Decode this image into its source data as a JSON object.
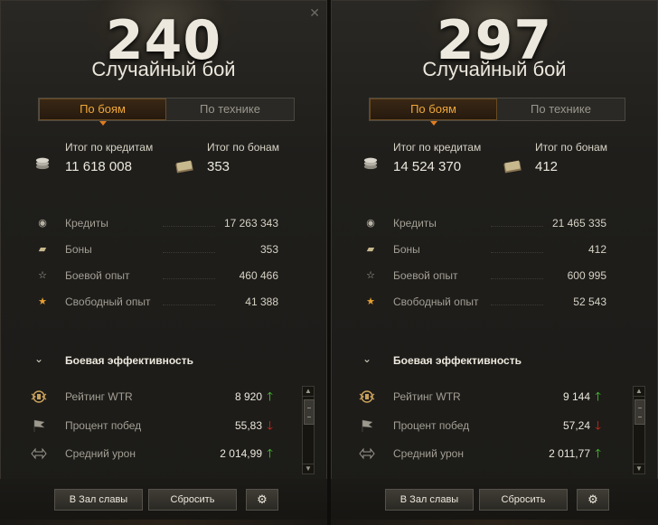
{
  "panels": [
    {
      "battle_count": "240",
      "mode_title": "Случайный бой",
      "tabs": [
        {
          "label": "По боям",
          "active": true
        },
        {
          "label": "По технике",
          "active": false
        }
      ],
      "summary": {
        "credits_label": "Итог по кредитам",
        "credits_value": "11 618 008",
        "bonds_label": "Итог по бонам",
        "bonds_value": "353"
      },
      "stats": [
        {
          "icon": "credits-icon",
          "label": "Кредиты",
          "value": "17 263 343"
        },
        {
          "icon": "bonds-icon",
          "label": "Боны",
          "value": "353"
        },
        {
          "icon": "star-outline-icon",
          "label": "Боевой опыт",
          "value": "460 466"
        },
        {
          "icon": "star-gold-icon",
          "label": "Свободный опыт",
          "value": "41 388"
        }
      ],
      "section_title": "Боевая эффективность",
      "efficiency": [
        {
          "icon": "wtr-rating-icon",
          "label": "Рейтинг WTR",
          "value": "8 920",
          "trend": "up"
        },
        {
          "icon": "flag-icon",
          "label": "Процент побед",
          "value": "55,83",
          "trend": "down"
        },
        {
          "icon": "damage-icon",
          "label": "Средний урон",
          "value": "2 014,99",
          "trend": "up"
        }
      ],
      "buttons": {
        "hall": "В Зал славы",
        "reset": "Сбросить"
      }
    },
    {
      "battle_count": "297",
      "mode_title": "Случайный бой",
      "tabs": [
        {
          "label": "По боям",
          "active": true
        },
        {
          "label": "По технике",
          "active": false
        }
      ],
      "summary": {
        "credits_label": "Итог по кредитам",
        "credits_value": "14 524 370",
        "bonds_label": "Итог по бонам",
        "bonds_value": "412"
      },
      "stats": [
        {
          "icon": "credits-icon",
          "label": "Кредиты",
          "value": "21 465 335"
        },
        {
          "icon": "bonds-icon",
          "label": "Боны",
          "value": "412"
        },
        {
          "icon": "star-outline-icon",
          "label": "Боевой опыт",
          "value": "600 995"
        },
        {
          "icon": "star-gold-icon",
          "label": "Свободный опыт",
          "value": "52 543"
        }
      ],
      "section_title": "Боевая эффективность",
      "efficiency": [
        {
          "icon": "wtr-rating-icon",
          "label": "Рейтинг WTR",
          "value": "9 144",
          "trend": "up"
        },
        {
          "icon": "flag-icon",
          "label": "Процент побед",
          "value": "57,24",
          "trend": "down"
        },
        {
          "icon": "damage-icon",
          "label": "Средний урон",
          "value": "2 011,77",
          "trend": "up"
        }
      ],
      "buttons": {
        "hall": "В Зал славы",
        "reset": "Сбросить"
      }
    }
  ],
  "colors": {
    "accent_tab": "#f0a83a",
    "trend_up": "#4cd132",
    "trend_down": "#d62a1a"
  }
}
